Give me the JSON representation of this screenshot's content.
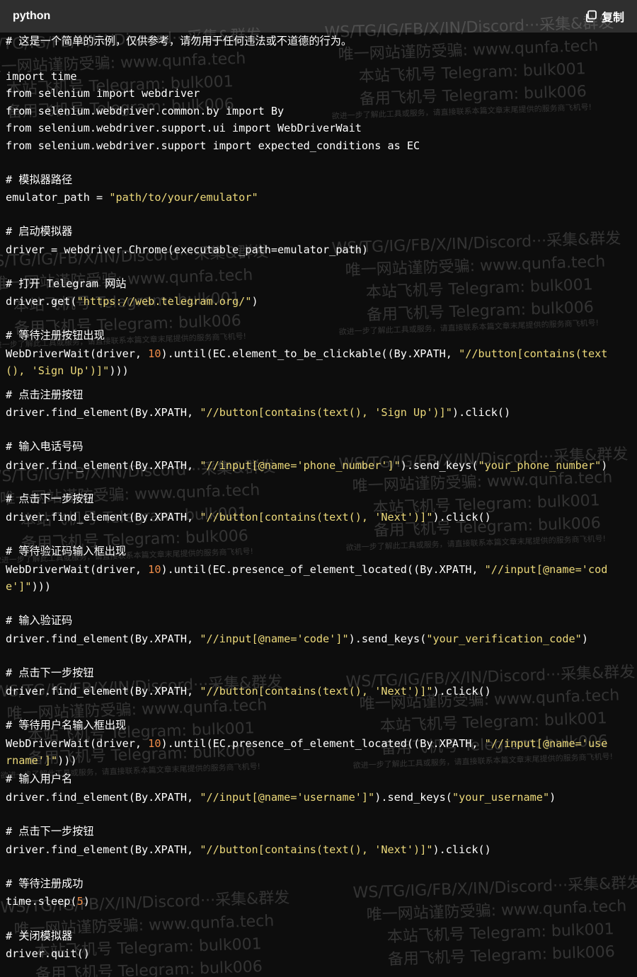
{
  "header": {
    "language": "python",
    "copy_label": "复制"
  },
  "code_lines": [
    "# 这是一个简单的示例，仅供参考，请勿用于任何违法或不道德的行为。",
    "",
    "import time",
    "from selenium import webdriver",
    "from selenium.webdriver.common.by import By",
    "from selenium.webdriver.support.ui import WebDriverWait",
    "from selenium.webdriver.support import expected_conditions as EC",
    "",
    "# 模拟器路径",
    "emulator_path = \"path/to/your/emulator\"",
    "",
    "# 启动模拟器",
    "driver = webdriver.Chrome(executable_path=emulator_path)",
    "",
    "# 打开 Telegram 网站",
    "driver.get(\"https://web.telegram.org/\")",
    "",
    "# 等待注册按钮出现",
    "WebDriverWait(driver, 10).until(EC.element_to_be_clickable((By.XPATH, \"//button[contains(text",
    "(), 'Sign Up')]\")))",
    "",
    "# 点击注册按钮",
    "driver.find_element(By.XPATH, \"//button[contains(text(), 'Sign Up')]\").click()",
    "",
    "# 输入电话号码",
    "driver.find_element(By.XPATH, \"//input[@name='phone_number']\").send_keys(\"your_phone_number\")",
    "",
    "# 点击下一步按钮",
    "driver.find_element(By.XPATH, \"//button[contains(text(), 'Next')]\").click()",
    "",
    "# 等待验证码输入框出现",
    "WebDriverWait(driver, 10).until(EC.presence_of_element_located((By.XPATH, \"//input[@name='cod",
    "e']\")))",
    "",
    "# 输入验证码",
    "driver.find_element(By.XPATH, \"//input[@name='code']\").send_keys(\"your_verification_code\")",
    "",
    "# 点击下一步按钮",
    "driver.find_element(By.XPATH, \"//button[contains(text(), 'Next')]\").click()",
    "",
    "# 等待用户名输入框出现",
    "WebDriverWait(driver, 10).until(EC.presence_of_element_located((By.XPATH, \"//input[@name='use",
    "rname']\")))",
    "# 输入用户名",
    "driver.find_element(By.XPATH, \"//input[@name='username']\").send_keys(\"your_username\")",
    "",
    "# 点击下一步按钮",
    "driver.find_element(By.XPATH, \"//button[contains(text(), 'Next')]\").click()",
    "",
    "# 等待注册成功",
    "time.sleep(5)",
    "",
    "# 关闭模拟器",
    "driver.quit()"
  ],
  "watermark": {
    "line1": "WS/TG/IG/FB/X/IN/Discord···采集&群发",
    "line2": "唯一网站谨防受骗:  www.qunfa.tech",
    "line3": "本站飞机号 Telegram:  bulk001",
    "line4": "备用飞机号 Telegram:  bulk006",
    "line5": "欲进一步了解此工具或服务，请直接联系本篇文章末尾提供的服务商飞机号!"
  },
  "colors": {
    "background": "#0d0d0d",
    "header": "#2f2f2f",
    "string": "#ecd97a",
    "number": "#f08d49",
    "text": "#ffffff"
  }
}
